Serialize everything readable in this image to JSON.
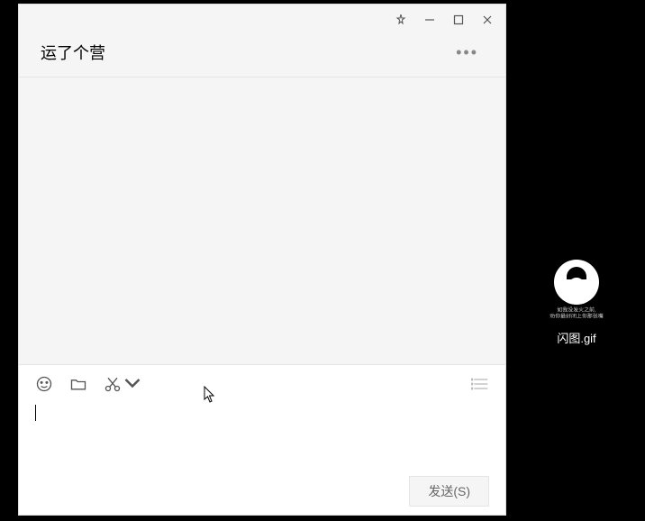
{
  "window": {
    "title": "运了个营"
  },
  "toolbar": {
    "send_label": "发送(S)"
  },
  "desktop": {
    "file_caption_line1": "如我没发火之前,",
    "file_caption_line2": "劝你最好闭上你那张嘴",
    "file_label": "闪图.gif"
  }
}
